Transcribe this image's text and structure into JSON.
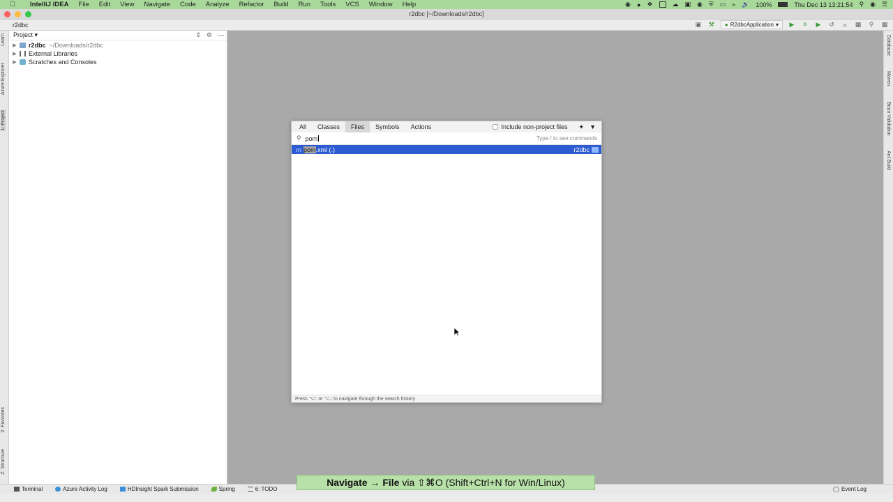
{
  "menubar": {
    "app_name": "IntelliJ IDEA",
    "items": [
      "File",
      "Edit",
      "View",
      "Navigate",
      "Code",
      "Analyze",
      "Refactor",
      "Build",
      "Run",
      "Tools",
      "VCS",
      "Window",
      "Help"
    ],
    "battery": "100%",
    "clock": "Thu Dec 13  13:21:54"
  },
  "window": {
    "title": "r2dbc [~/Downloads/r2dbc]"
  },
  "navbar": {
    "breadcrumb": "r2dbc",
    "run_config": "R2dbcApplication"
  },
  "left_strip": {
    "tabs": [
      "Learn",
      "Azure Explorer",
      "1: Project",
      "2: Favorites",
      "Z: Structure"
    ]
  },
  "right_strip": {
    "tabs": [
      "Database",
      "Maven",
      "Bean Validation",
      "Ant Build"
    ]
  },
  "project": {
    "title": "Project",
    "tree": [
      {
        "name": "r2dbc",
        "path": "~/Downloads/r2dbc",
        "bold": true
      },
      {
        "name": "External Libraries",
        "path": ""
      },
      {
        "name": "Scratches and Consoles",
        "path": ""
      }
    ]
  },
  "search_popup": {
    "tabs": [
      "All",
      "Classes",
      "Files",
      "Symbols",
      "Actions"
    ],
    "active_tab": "Files",
    "include_label": "Include non-project files",
    "query": "pom",
    "hint": "Type / to see commands",
    "result": {
      "icon": "m",
      "match": "pom",
      "rest": ".xml (.)",
      "location": "r2dbc"
    },
    "footer": "Press ⌥↑ or ⌥↓ to navigate through the search history"
  },
  "bottom_bar": {
    "tools": [
      "Terminal",
      "Azure Activity Log",
      "HDInsight Spark Submission",
      "Spring",
      "6: TODO"
    ],
    "event_log": "Event Log"
  },
  "caption": {
    "bold": "Navigate → File",
    "rest": " via ⇧⌘O (Shift+Ctrl+N for Win/Linux)"
  },
  "colors": {
    "selection": "#2d5bd1",
    "menubar": "#a8d99a",
    "caption": "#b8e0a9"
  }
}
